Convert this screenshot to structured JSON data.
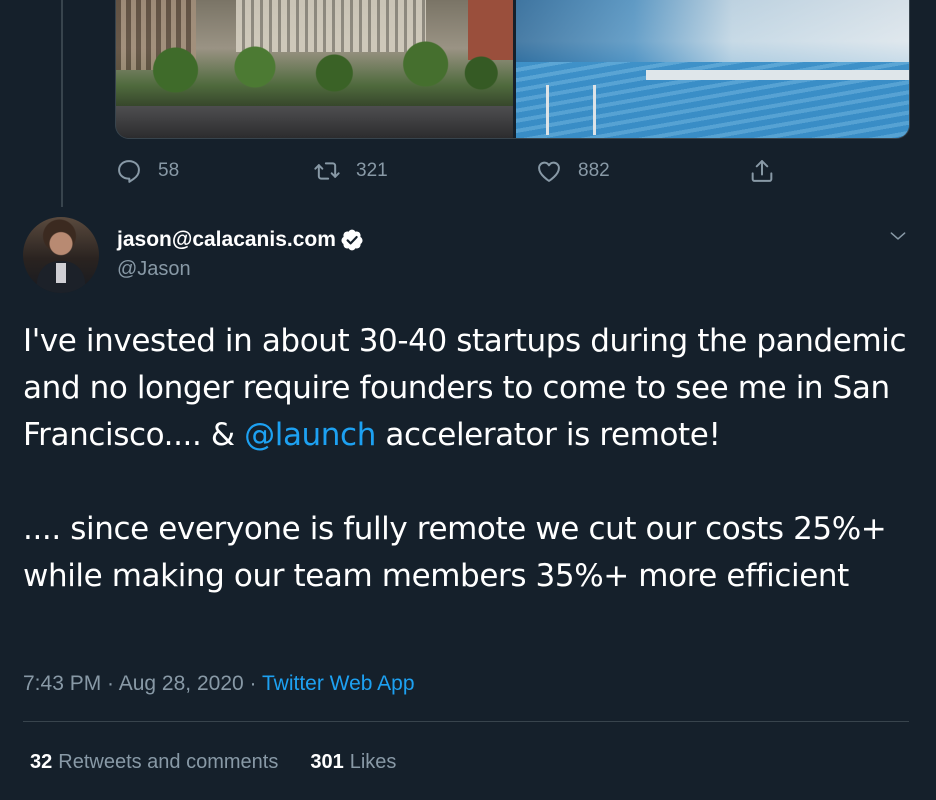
{
  "previous_tweet": {
    "media": [
      {
        "icon": "building-photo"
      },
      {
        "icon": "pool-photo"
      }
    ],
    "actions": {
      "reply_count": "58",
      "retweet_count": "321",
      "like_count": "882"
    }
  },
  "tweet": {
    "author": {
      "display_name": "jason@calacanis.com",
      "handle": "@Jason",
      "verified": true
    },
    "text": {
      "line_1": "I've invested in about 30-40 startups during the pandemic and no longer require founders to come to see me in San Francisco.... & ",
      "mention": "@launch",
      "line_1_tail": " accelerator is remote!",
      "line_2": ".... since everyone is fully remote we cut our costs 25%+ while making our team members 35%+ more efficient"
    },
    "meta": {
      "time": "7:43 PM",
      "separator_1": " · ",
      "date": "Aug 28, 2020",
      "separator_2": " · ",
      "source": "Twitter Web App"
    },
    "stats": {
      "retweets_count": "32",
      "retweets_label": "Retweets and comments",
      "likes_count": "301",
      "likes_label": "Likes"
    }
  },
  "colors": {
    "background": "#15202b",
    "accent": "#1da1f2",
    "muted": "#8899a6",
    "divider": "#38444d"
  }
}
